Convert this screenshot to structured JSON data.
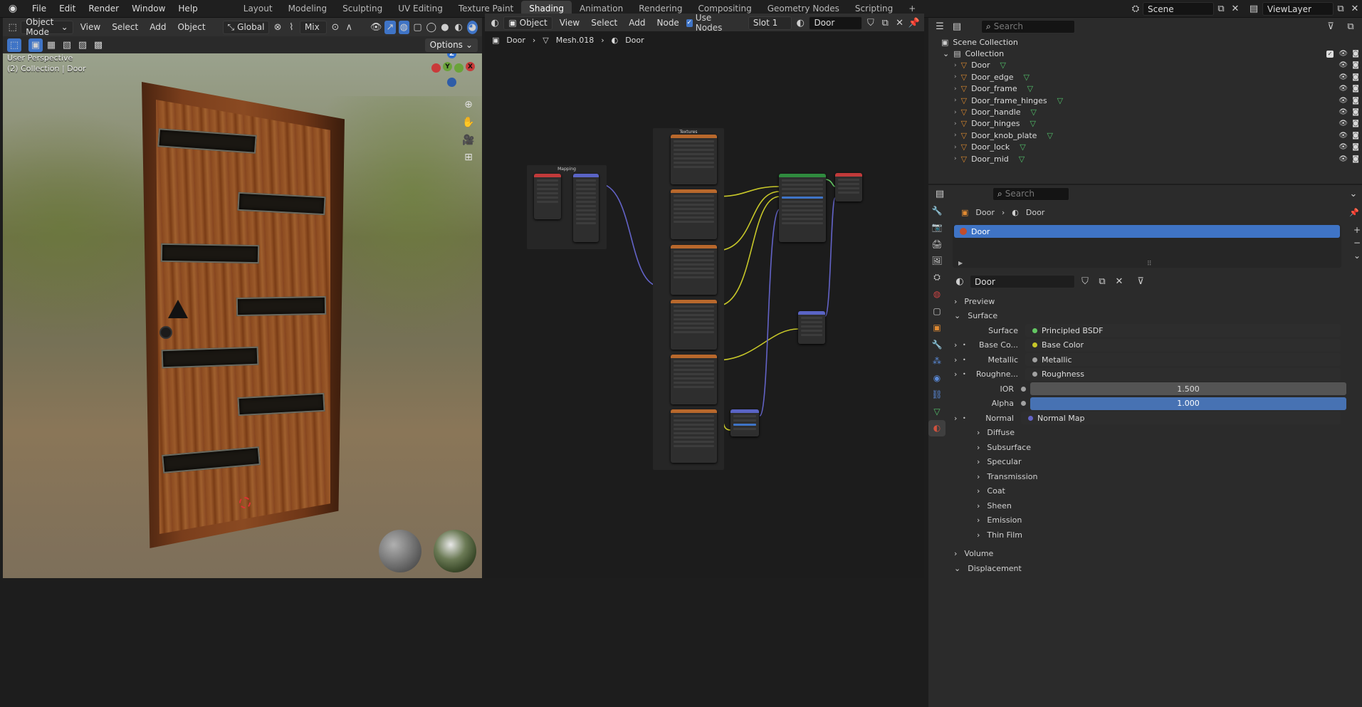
{
  "menu": [
    "File",
    "Edit",
    "Render",
    "Window",
    "Help"
  ],
  "workspaces": [
    "Layout",
    "Modeling",
    "Sculpting",
    "UV Editing",
    "Texture Paint",
    "Shading",
    "Animation",
    "Rendering",
    "Compositing",
    "Geometry Nodes",
    "Scripting"
  ],
  "active_workspace": "Shading",
  "scene": {
    "name": "Scene",
    "view_layer": "ViewLayer"
  },
  "viewport": {
    "mode": "Object Mode",
    "menus": [
      "View",
      "Select",
      "Add",
      "Object"
    ],
    "transform": "Global",
    "snap": "Mix",
    "options_label": "Options",
    "perspective_label": "User Perspective",
    "collection_label": "(2) Collection | Door",
    "gizmo": {
      "x": "X",
      "y": "Y",
      "z": "Z"
    }
  },
  "node_editor": {
    "object_mode": "Object",
    "menus": [
      "View",
      "Select",
      "Add",
      "Node"
    ],
    "use_nodes_label": "Use Nodes",
    "slot": "Slot 1",
    "material": "Door",
    "breadcrumb": [
      "Door",
      "Mesh.018",
      "Door"
    ],
    "frames": {
      "mapping": "Mapping",
      "textures": "Textures"
    }
  },
  "outliner": {
    "search_placeholder": "Search",
    "scene_collection": "Scene Collection",
    "collection": "Collection",
    "items": [
      "Door",
      "Door_edge",
      "Door_frame",
      "Door_frame_hinges",
      "Door_handle",
      "Door_hinges",
      "Door_knob_plate",
      "Door_lock",
      "Door_mid"
    ]
  },
  "properties": {
    "search_placeholder": "Search",
    "breadcrumb": [
      "Door",
      "Door"
    ],
    "material_slot": "Door",
    "material_name": "Door",
    "sections_top": [
      "Preview",
      "Surface"
    ],
    "surface_rows": [
      {
        "label": "Surface",
        "value": "Principled BSDF",
        "color": "#63c763"
      },
      {
        "label": "Base Co...",
        "value": "Base Color",
        "color": "#c7c729"
      },
      {
        "label": "Metallic",
        "value": "Metallic",
        "color": "#a1a1a1"
      },
      {
        "label": "Roughne...",
        "value": "Roughness",
        "color": "#a1a1a1"
      }
    ],
    "ior": {
      "label": "IOR",
      "value": "1.500"
    },
    "alpha": {
      "label": "Alpha",
      "value": "1.000"
    },
    "normal": {
      "label": "Normal",
      "value": "Normal Map",
      "color": "#6363c7"
    },
    "subsections": [
      "Diffuse",
      "Subsurface",
      "Specular",
      "Transmission",
      "Coat",
      "Sheen",
      "Emission",
      "Thin Film"
    ],
    "bottom_sections": [
      "Volume",
      "Displacement"
    ]
  },
  "colors": {
    "accent": "#4772b3",
    "active_blue": "#3f74c6",
    "node_link_yellow": "#c7c729",
    "node_link_purple": "#6363c7"
  }
}
